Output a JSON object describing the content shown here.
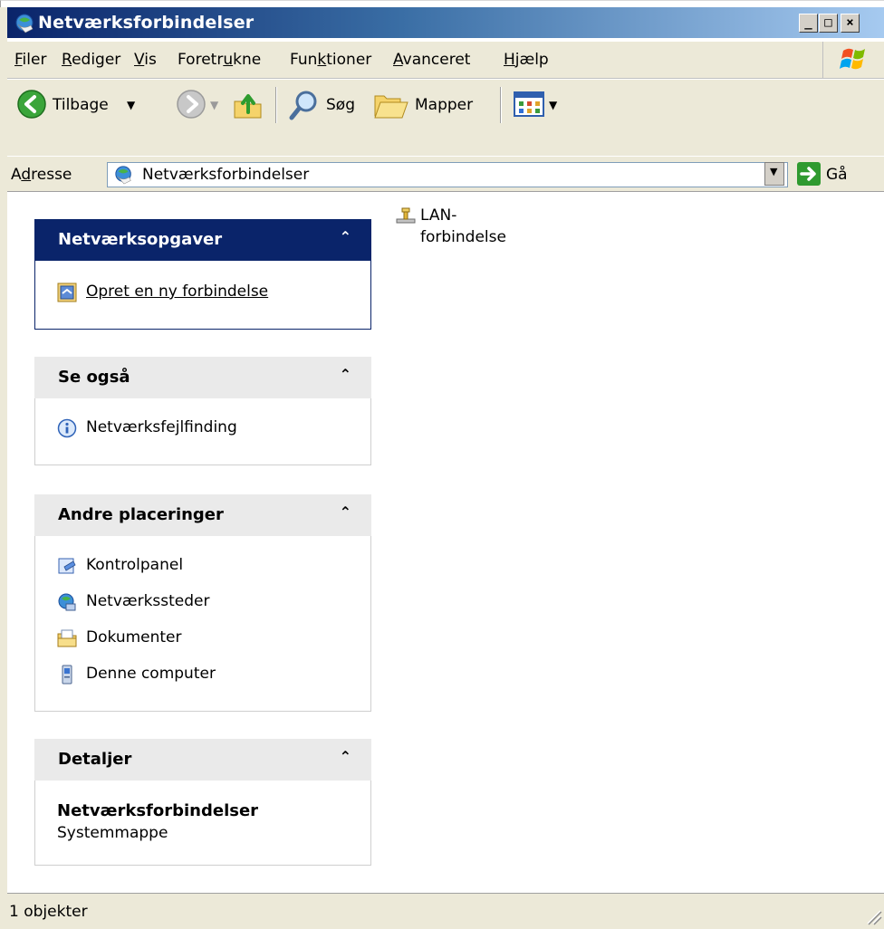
{
  "window": {
    "title": "Netværksforbindelser",
    "minimize": "_",
    "maximize": "□",
    "close": "×"
  },
  "menu": [
    {
      "pre": "",
      "u": "F",
      "post": "iler"
    },
    {
      "pre": "",
      "u": "R",
      "post": "ediger"
    },
    {
      "pre": "",
      "u": "V",
      "post": "is"
    },
    {
      "pre": "Foretr",
      "u": "u",
      "post": "kne"
    },
    {
      "pre": "Fun",
      "u": "k",
      "post": "tioner"
    },
    {
      "pre": "",
      "u": "A",
      "post": "vanceret"
    },
    {
      "pre": "",
      "u": "H",
      "post": "jælp"
    }
  ],
  "toolbar": {
    "back_label": "Tilbage",
    "search_label": "Søg",
    "folders_label": "Mapper"
  },
  "address": {
    "label_pre": "A",
    "label_u": "d",
    "label_post": "resse",
    "value": "Netværksforbindelser",
    "go_label": "Gå"
  },
  "panels": {
    "network_tasks": {
      "title": "Netværksopgaver",
      "items": [
        "Opret en ny forbindelse"
      ]
    },
    "see_also": {
      "title": "Se også",
      "items": [
        "Netværksfejlfinding"
      ]
    },
    "other_places": {
      "title": "Andre placeringer",
      "items": [
        "Kontrolpanel",
        "Netværkssteder",
        "Dokumenter",
        "Denne computer"
      ]
    },
    "details": {
      "title": "Detaljer",
      "name": "Netværksforbindelser",
      "type": "Systemmappe"
    },
    "collapse_glyph": "⌃"
  },
  "files": [
    {
      "name": "LAN-forbindelse"
    }
  ],
  "status": {
    "text": "1 objekter"
  },
  "colors": {
    "title_start": "#0a246a",
    "title_end": "#a6caf0",
    "task_header": "#0a246a",
    "chrome": "#ece9d8"
  }
}
